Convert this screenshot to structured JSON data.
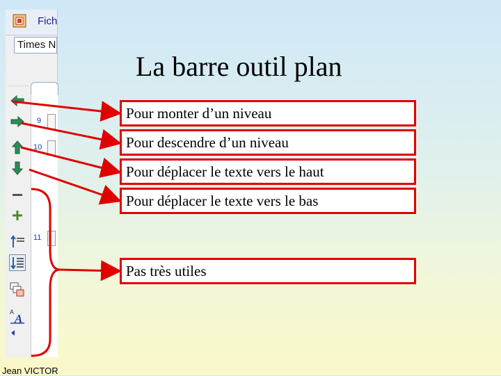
{
  "app": {
    "menu_fragment": "Fich",
    "font_name_fragment": "Times N"
  },
  "outline": {
    "slide_numbers": [
      "9",
      "10",
      "11"
    ]
  },
  "toolbar_buttons": [
    {
      "name": "promote-left-arrow-icon"
    },
    {
      "name": "demote-right-arrow-icon"
    },
    {
      "name": "move-up-arrow-icon"
    },
    {
      "name": "move-down-arrow-icon"
    },
    {
      "name": "collapse-minus-icon"
    },
    {
      "name": "expand-plus-icon"
    },
    {
      "name": "collapse-all-icon"
    },
    {
      "name": "expand-all-icon"
    },
    {
      "name": "summary-slide-icon"
    },
    {
      "name": "show-formatting-icon"
    }
  ],
  "slide": {
    "title": "La barre outil plan",
    "callouts": [
      "Pour monter d’un niveau",
      "Pour descendre d’un niveau",
      "Pour déplacer le texte vers le haut",
      "Pour déplacer le texte vers le bas",
      "Pas très utiles"
    ],
    "author": "Jean VICTOR"
  },
  "colors": {
    "callout_border": "#e00000",
    "arrow_color": "#e00000",
    "icon_green": "#2e8b57",
    "icon_blue": "#2a5db0"
  }
}
